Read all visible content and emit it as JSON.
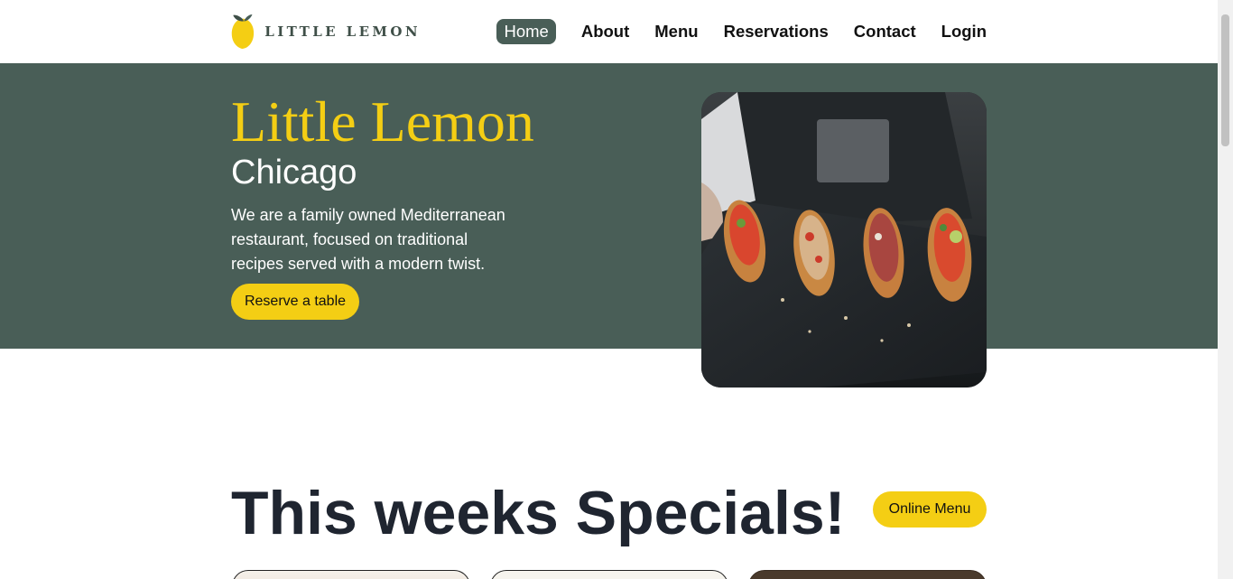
{
  "header": {
    "logo_text": "LITTLE LEMON",
    "nav": [
      {
        "label": "Home",
        "active": true
      },
      {
        "label": "About"
      },
      {
        "label": "Menu"
      },
      {
        "label": "Reservations"
      },
      {
        "label": "Contact"
      },
      {
        "label": "Login"
      }
    ]
  },
  "hero": {
    "title": "Little Lemon",
    "subtitle": "Chicago",
    "description": "We are a family owned Mediterranean restaurant, focused on traditional recipes served with a modern twist.",
    "cta_label": "Reserve a table"
  },
  "specials": {
    "title": "This weeks Specials!",
    "button_label": "Online Menu"
  },
  "colors": {
    "primary_green": "#495e57",
    "primary_yellow": "#f4ce14",
    "heading_dark": "#1f2530"
  }
}
